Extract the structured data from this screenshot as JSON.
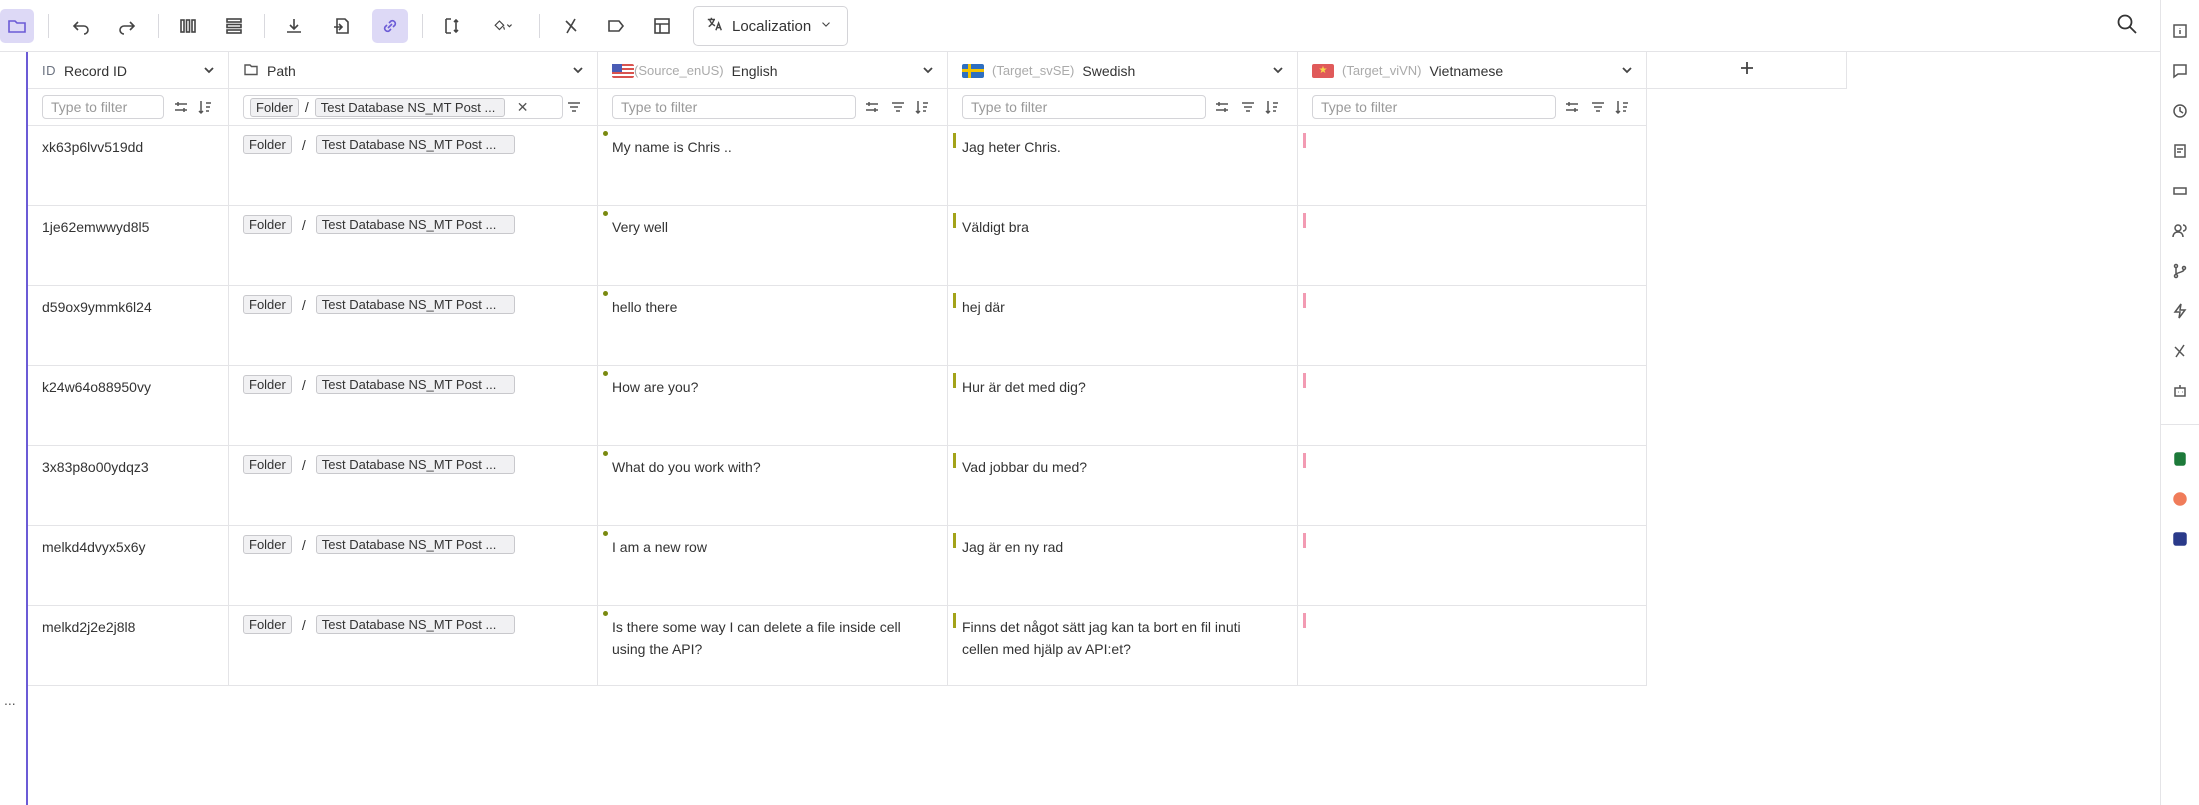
{
  "toolbar": {
    "localization_label": "Localization"
  },
  "columns": {
    "record_id": {
      "prefix": "ID",
      "label": "Record ID"
    },
    "path": {
      "label": "Path"
    },
    "english": {
      "tag": "(Source_enUS)",
      "label": "English"
    },
    "swedish": {
      "tag": "(Target_svSE)",
      "label": "Swedish"
    },
    "vietnamese": {
      "tag": "(Target_viVN)",
      "label": "Vietnamese"
    }
  },
  "filters": {
    "placeholder": "Type to filter",
    "path_chip_folder": "Folder",
    "path_chip_sep": "/",
    "path_chip_db": "Test Database NS_MT Post ..."
  },
  "rows": [
    {
      "id": "xk63p6lvv519dd",
      "folder": "Folder",
      "sep": "/",
      "db": "Test Database NS_MT Post ...",
      "en": "My name is Chris ..",
      "sv": "Jag heter Chris.",
      "vi": ""
    },
    {
      "id": "1je62emwwyd8l5",
      "folder": "Folder",
      "sep": "/",
      "db": "Test Database NS_MT Post ...",
      "en": "Very well",
      "sv": "Väldigt bra",
      "vi": ""
    },
    {
      "id": "d59ox9ymmk6l24",
      "folder": "Folder",
      "sep": "/",
      "db": "Test Database NS_MT Post ...",
      "en": "hello there",
      "sv": "hej där",
      "vi": ""
    },
    {
      "id": "k24w64o88950vy",
      "folder": "Folder",
      "sep": "/",
      "db": "Test Database NS_MT Post ...",
      "en": "How are you?",
      "sv": "Hur är det med dig?",
      "vi": ""
    },
    {
      "id": "3x83p8o00ydqz3",
      "folder": "Folder",
      "sep": "/",
      "db": "Test Database NS_MT Post ...",
      "en": "What do you work with?",
      "sv": "Vad jobbar du med?",
      "vi": ""
    },
    {
      "id": "melkd4dvyx5x6y",
      "folder": "Folder",
      "sep": "/",
      "db": "Test Database NS_MT Post ...",
      "en": "I am a new row",
      "sv": "Jag är en ny rad",
      "vi": ""
    },
    {
      "id": "melkd2j2e2j8l8",
      "folder": "Folder",
      "sep": "/",
      "db": "Test Database NS_MT Post ...",
      "en": " Is there some way I can delete a file inside cell using the API?",
      "sv": " Finns det något sätt jag kan ta bort en fil inuti cellen med hjälp av API:et?",
      "vi": ""
    }
  ],
  "gutter": {
    "dots": "..."
  },
  "colors": {
    "accent": "#6b5bd6",
    "active_bg": "#ddd9f6",
    "source_marker": "#7a8a10",
    "target_marker_sv": "#a3a31a",
    "target_marker_vi": "#f29bb3"
  },
  "icons": [
    "folder-icon",
    "undo-icon",
    "redo-icon",
    "columns-icon",
    "rows-icon",
    "download-icon",
    "import-icon",
    "link-icon",
    "split-icon",
    "paint-bucket-icon",
    "function-icon",
    "tag-icon",
    "table-icon",
    "translate-icon",
    "search-icon"
  ]
}
